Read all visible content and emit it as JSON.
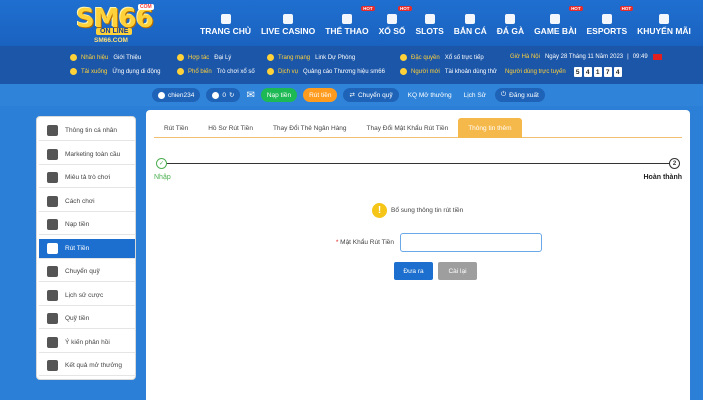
{
  "logo": {
    "main": "SM66",
    "tagline": "ON LINE",
    "domain": "SM66.COM",
    "badge": "COM"
  },
  "menu": [
    {
      "label": "TRANG CHỦ",
      "icon": "home-icon",
      "hot": ""
    },
    {
      "label": "LIVE CASINO",
      "icon": "cards-icon",
      "hot": ""
    },
    {
      "label": "THỂ THAO",
      "icon": "soccer-icon",
      "hot": "HOT"
    },
    {
      "label": "XỔ SỐ",
      "icon": "lottery-icon",
      "hot": "HOT"
    },
    {
      "label": "SLOTS",
      "icon": "slot-icon",
      "hot": ""
    },
    {
      "label": "BẮN CÁ",
      "icon": "fish-icon",
      "hot": ""
    },
    {
      "label": "ĐÁ GÀ",
      "icon": "rooster-icon",
      "hot": ""
    },
    {
      "label": "GAME BÀI",
      "icon": "card-game-icon",
      "hot": "HOT"
    },
    {
      "label": "ESPORTS",
      "icon": "gamepad-icon",
      "hot": "HOT"
    },
    {
      "label": "KHUYẾN MÃI",
      "icon": "gift-icon",
      "hot": ""
    }
  ],
  "info": {
    "nhan_hieu": {
      "label": "Nhãn hiệu",
      "value": "Giới Thiệu"
    },
    "tai_xuong": {
      "label": "Tải xuống",
      "value": "Ứng dụng di động"
    },
    "hop_tac": {
      "label": "Hợp tác",
      "value": "Đại Lý"
    },
    "pho_bien": {
      "label": "Phổ biến",
      "value": "Trò chơi xổ số"
    },
    "trang_mang": {
      "label": "Trang mạng",
      "value": "Link Dự Phòng"
    },
    "dich_vu": {
      "label": "Dịch vụ",
      "value": "Quảng cáo Thương hiệu sm66"
    },
    "dac_quyen": {
      "label": "Đặc quyền",
      "value": "Xổ số trực tiếp"
    },
    "nguoi_moi": {
      "label": "Người mới",
      "value": "Tài khoản dùng thử"
    },
    "gio": {
      "label": "Giờ Hà Nội",
      "value": "Ngày 28 Tháng 11 Năm 2023",
      "time": "09:49"
    },
    "online": {
      "label": "Người dùng trực tuyến",
      "digits": [
        "5",
        "4",
        "1",
        "7",
        "4"
      ]
    }
  },
  "account": {
    "username": "chien234",
    "balance": "0",
    "nap_tien": "Nạp tiền",
    "rut_tien": "Rút tiền",
    "chuyen_quy": "Chuyển quỹ",
    "kq": "KQ Mở thưởng",
    "lich_su": "Lịch Sử",
    "dang_xuat": "Đăng xuất"
  },
  "sidebar": [
    {
      "label": "Thông tin cá nhân",
      "icon": "user-card-icon",
      "active": false
    },
    {
      "label": "Marketing toàn cầu",
      "icon": "diamond-icon",
      "active": false
    },
    {
      "label": "Miêu tả trò chơi",
      "icon": "gamepad-icon",
      "active": false
    },
    {
      "label": "Cách chơi",
      "icon": "compass-icon",
      "active": false
    },
    {
      "label": "Nạp tiền",
      "icon": "piggy-bank-icon",
      "active": false
    },
    {
      "label": "Rút Tiền",
      "icon": "bank-icon",
      "active": true
    },
    {
      "label": "Chuyển quỹ",
      "icon": "exchange-icon",
      "active": false
    },
    {
      "label": "Lịch sử cược",
      "icon": "document-icon",
      "active": false
    },
    {
      "label": "Quỹ tiền",
      "icon": "money-icon",
      "active": false
    },
    {
      "label": "Ý kiến phản hồi",
      "icon": "comment-icon",
      "active": false
    },
    {
      "label": "Kết quả mở thưởng",
      "icon": "history-icon",
      "active": false
    }
  ],
  "tabs": [
    {
      "label": "Rút Tiền",
      "active": false
    },
    {
      "label": "Hồ Sơ Rút Tiền",
      "active": false
    },
    {
      "label": "Thay Đổi Thẻ Ngân Hàng",
      "active": false
    },
    {
      "label": "Thay Đổi Mật Khẩu Rút Tiền",
      "active": false
    },
    {
      "label": "Thông tin thêm",
      "active": true
    }
  ],
  "steps": {
    "step1_icon": "✓",
    "step1_label": "Nhập",
    "step2_number": "2",
    "step2_label": "Hoàn thành"
  },
  "form": {
    "notice": "Bổ sung thông tin rút tiền",
    "notice_icon": "!",
    "required_mark": "*",
    "password_label": "Mật Khẩu Rút Tiền",
    "password_value": "",
    "submit_label": "Đưa ra",
    "reset_label": "Cài lại"
  }
}
